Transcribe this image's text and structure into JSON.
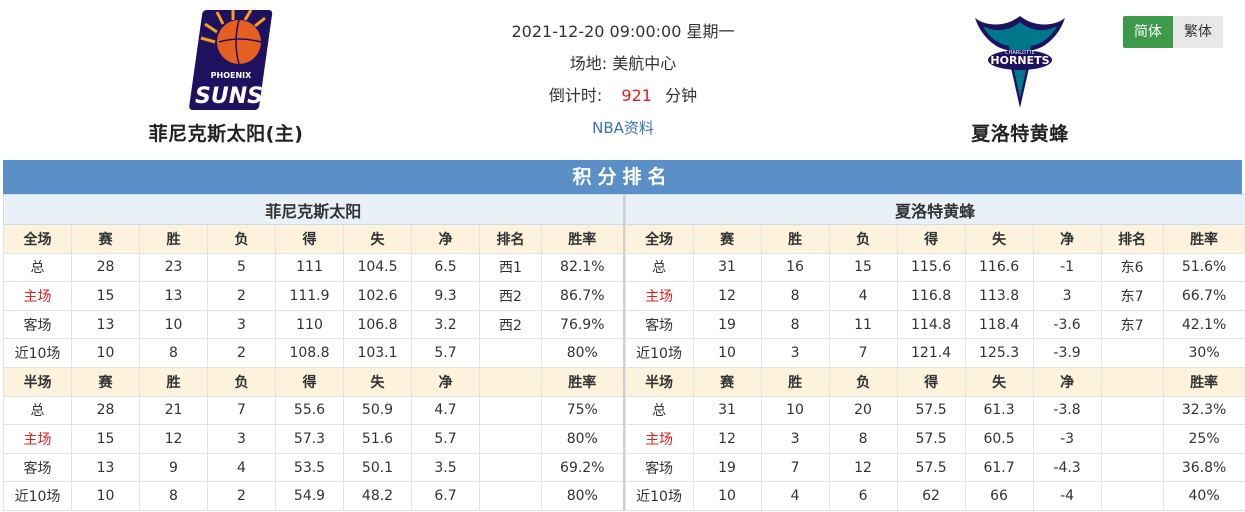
{
  "header": {
    "home_team": {
      "name": "菲尼克斯太阳(主)",
      "logo_icon": "phoenix-suns-logo"
    },
    "away_team": {
      "name": "夏洛特黄蜂",
      "logo_icon": "charlotte-hornets-logo"
    },
    "datetime": "2021-12-20 09:00:00 星期一",
    "venue_label": "场地:",
    "venue": "美航中心",
    "countdown_label": "倒计时:",
    "countdown_value": "921",
    "countdown_unit": "分钟",
    "data_link": "NBA资料",
    "lang_simplified": "简体",
    "lang_traditional": "繁体"
  },
  "standings": {
    "title": "积分排名",
    "home": {
      "team_name": "菲尼克斯太阳",
      "full_headers": [
        "全场",
        "赛",
        "胜",
        "负",
        "得",
        "失",
        "净",
        "排名",
        "胜率"
      ],
      "full_rows": [
        [
          "总",
          "28",
          "23",
          "5",
          "111",
          "104.5",
          "6.5",
          "西1",
          "82.1%"
        ],
        [
          "主场",
          "15",
          "13",
          "2",
          "111.9",
          "102.6",
          "9.3",
          "西2",
          "86.7%"
        ],
        [
          "客场",
          "13",
          "10",
          "3",
          "110",
          "106.8",
          "3.2",
          "西2",
          "76.9%"
        ],
        [
          "近10场",
          "10",
          "8",
          "2",
          "108.8",
          "103.1",
          "5.7",
          "",
          "80%"
        ]
      ],
      "half_headers": [
        "半场",
        "赛",
        "胜",
        "负",
        "得",
        "失",
        "净",
        "",
        "胜率"
      ],
      "half_rows": [
        [
          "总",
          "28",
          "21",
          "7",
          "55.6",
          "50.9",
          "4.7",
          "",
          "75%"
        ],
        [
          "主场",
          "15",
          "12",
          "3",
          "57.3",
          "51.6",
          "5.7",
          "",
          "80%"
        ],
        [
          "客场",
          "13",
          "9",
          "4",
          "53.5",
          "50.1",
          "3.5",
          "",
          "69.2%"
        ],
        [
          "近10场",
          "10",
          "8",
          "2",
          "54.9",
          "48.2",
          "6.7",
          "",
          "80%"
        ]
      ]
    },
    "away": {
      "team_name": "夏洛特黄蜂",
      "full_headers": [
        "全场",
        "赛",
        "胜",
        "负",
        "得",
        "失",
        "净",
        "排名",
        "胜率"
      ],
      "full_rows": [
        [
          "总",
          "31",
          "16",
          "15",
          "115.6",
          "116.6",
          "-1",
          "东6",
          "51.6%"
        ],
        [
          "主场",
          "12",
          "8",
          "4",
          "116.8",
          "113.8",
          "3",
          "东7",
          "66.7%"
        ],
        [
          "客场",
          "19",
          "8",
          "11",
          "114.8",
          "118.4",
          "-3.6",
          "东7",
          "42.1%"
        ],
        [
          "近10场",
          "10",
          "3",
          "7",
          "121.4",
          "125.3",
          "-3.9",
          "",
          "30%"
        ]
      ],
      "half_headers": [
        "半场",
        "赛",
        "胜",
        "负",
        "得",
        "失",
        "净",
        "",
        "胜率"
      ],
      "half_rows": [
        [
          "总",
          "31",
          "10",
          "20",
          "57.5",
          "61.3",
          "-3.8",
          "",
          "32.3%"
        ],
        [
          "主场",
          "12",
          "3",
          "8",
          "57.5",
          "60.5",
          "-3",
          "",
          "25%"
        ],
        [
          "客场",
          "19",
          "7",
          "12",
          "57.5",
          "61.7",
          "-4.3",
          "",
          "36.8%"
        ],
        [
          "近10场",
          "10",
          "4",
          "6",
          "62",
          "66",
          "-4",
          "",
          "40%"
        ]
      ]
    }
  },
  "colors": {
    "accent_blue": "#5a8fc8",
    "home_red": "#e02020",
    "active_green": "#3c9a4a",
    "header_cream": "#fdf3dc"
  }
}
